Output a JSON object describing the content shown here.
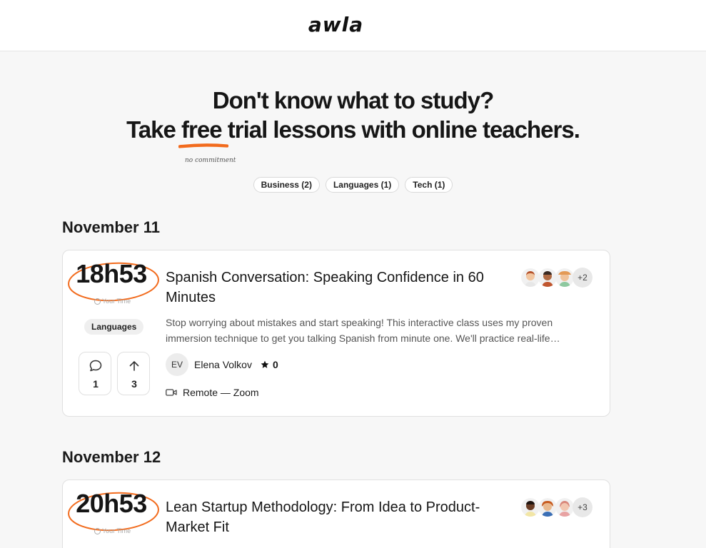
{
  "brand": {
    "logo": "awla"
  },
  "hero": {
    "line1": "Don't know what to study?",
    "line2_before": "Take ",
    "line2_highlight": "free",
    "line2_after": " trial lessons with online teachers.",
    "highlight_note": "no commitment",
    "accent_color": "#f26b1d"
  },
  "filters": [
    {
      "label": "Business (2)"
    },
    {
      "label": "Languages (1)"
    },
    {
      "label": "Tech (1)"
    }
  ],
  "sections": [
    {
      "date": "November 11",
      "event": {
        "time": "18h53",
        "time_caption": "Your Time",
        "category": "Languages",
        "comments": "1",
        "upvotes": "3",
        "title": "Spanish Conversation: Speaking Confidence in 60 Minutes",
        "description": "Stop worrying about mistakes and start speaking! This interactive class uses my proven immersion technique to get you talking Spanish from minute one. We'll practice real-life…",
        "teacher_initials": "EV",
        "teacher_name": "Elena Volkov",
        "rating": "0",
        "location": "Remote — Zoom",
        "extra_attendees": "+2"
      }
    },
    {
      "date": "November 12",
      "event": {
        "time": "20h53",
        "time_caption": "Your Time",
        "title": "Lean Startup Methodology: From Idea to Product-Market Fit",
        "extra_attendees": "+3"
      }
    }
  ]
}
